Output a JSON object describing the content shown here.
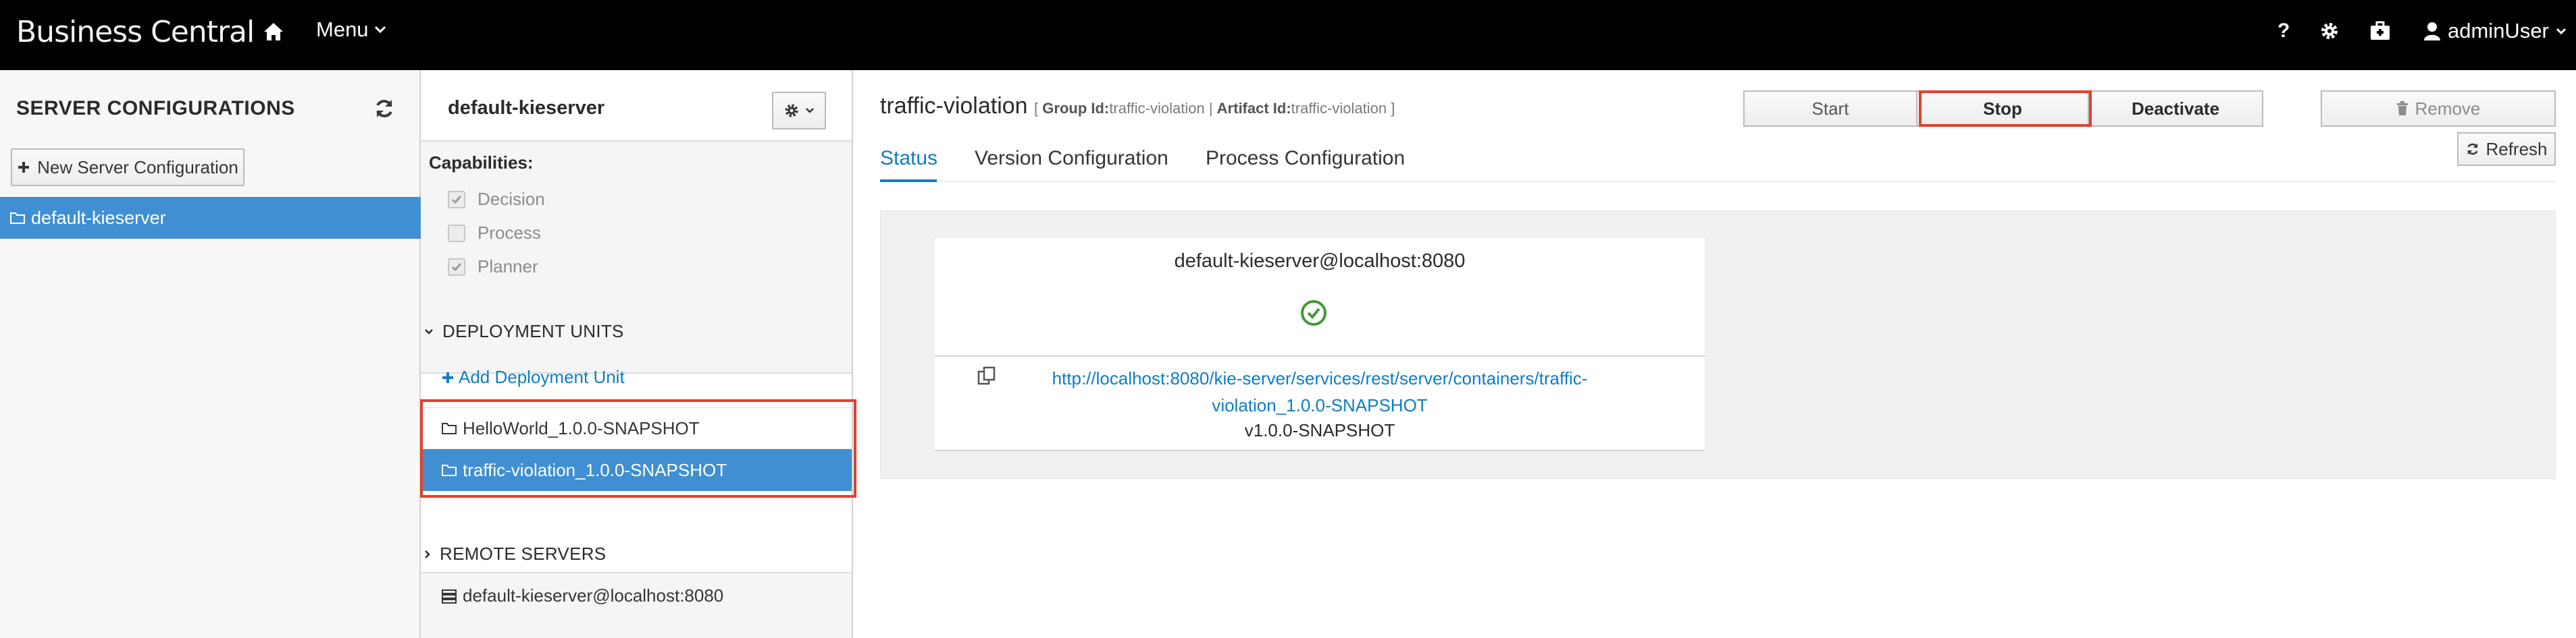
{
  "topbar": {
    "brand": "Business Central",
    "home_icon": "home-icon",
    "menu_label": "Menu",
    "help_label": "?",
    "settings_icon": "gear-icon",
    "briefcase_icon": "briefcase-icon",
    "user_label": "adminUser"
  },
  "servers": {
    "title": "SERVER CONFIGURATIONS",
    "refresh_icon": "refresh-icon",
    "new_button": "New Server Configuration",
    "items": [
      {
        "label": "default-kieserver"
      }
    ]
  },
  "server_detail": {
    "title": "default-kieserver",
    "capabilities_title": "Capabilities:",
    "capabilities": [
      {
        "label": "Decision",
        "checked": true
      },
      {
        "label": "Process",
        "checked": false
      },
      {
        "label": "Planner",
        "checked": true
      }
    ],
    "deployment_units_title": "DEPLOYMENT UNITS",
    "add_deployment_unit": "Add Deployment Unit",
    "deployment_units": [
      {
        "label": "HelloWorld_1.0.0-SNAPSHOT",
        "selected": false
      },
      {
        "label": "traffic-violation_1.0.0-SNAPSHOT",
        "selected": true
      }
    ],
    "remote_servers_title": "REMOTE SERVERS",
    "remote_servers": [
      {
        "label": "default-kieserver@localhost:8080"
      }
    ]
  },
  "container": {
    "name": "traffic-violation",
    "meta_open": "[",
    "group_label": "Group Id:",
    "group_value": "traffic-violation",
    "separator": "|",
    "artifact_label": "Artifact Id:",
    "artifact_value": "traffic-violation",
    "meta_close": "]",
    "actions": {
      "start": "Start",
      "stop": "Stop",
      "deactivate": "Deactivate",
      "remove": "Remove",
      "refresh": "Refresh"
    },
    "tabs": [
      {
        "label": "Status",
        "active": true
      },
      {
        "label": "Version Configuration",
        "active": false
      },
      {
        "label": "Process Configuration",
        "active": false
      }
    ],
    "status_card": {
      "server": "default-kieserver@localhost:8080",
      "url": "http://localhost:8080/kie-server/services/rest/server/containers/traffic-violation_1.0.0-SNAPSHOT",
      "version": "v1.0.0-SNAPSHOT"
    }
  },
  "colors": {
    "accent": "#0f7dc3",
    "selected": "#3f8fd2",
    "highlight": "#e0412d",
    "success": "#3f9c35",
    "topbar": "#000000"
  }
}
